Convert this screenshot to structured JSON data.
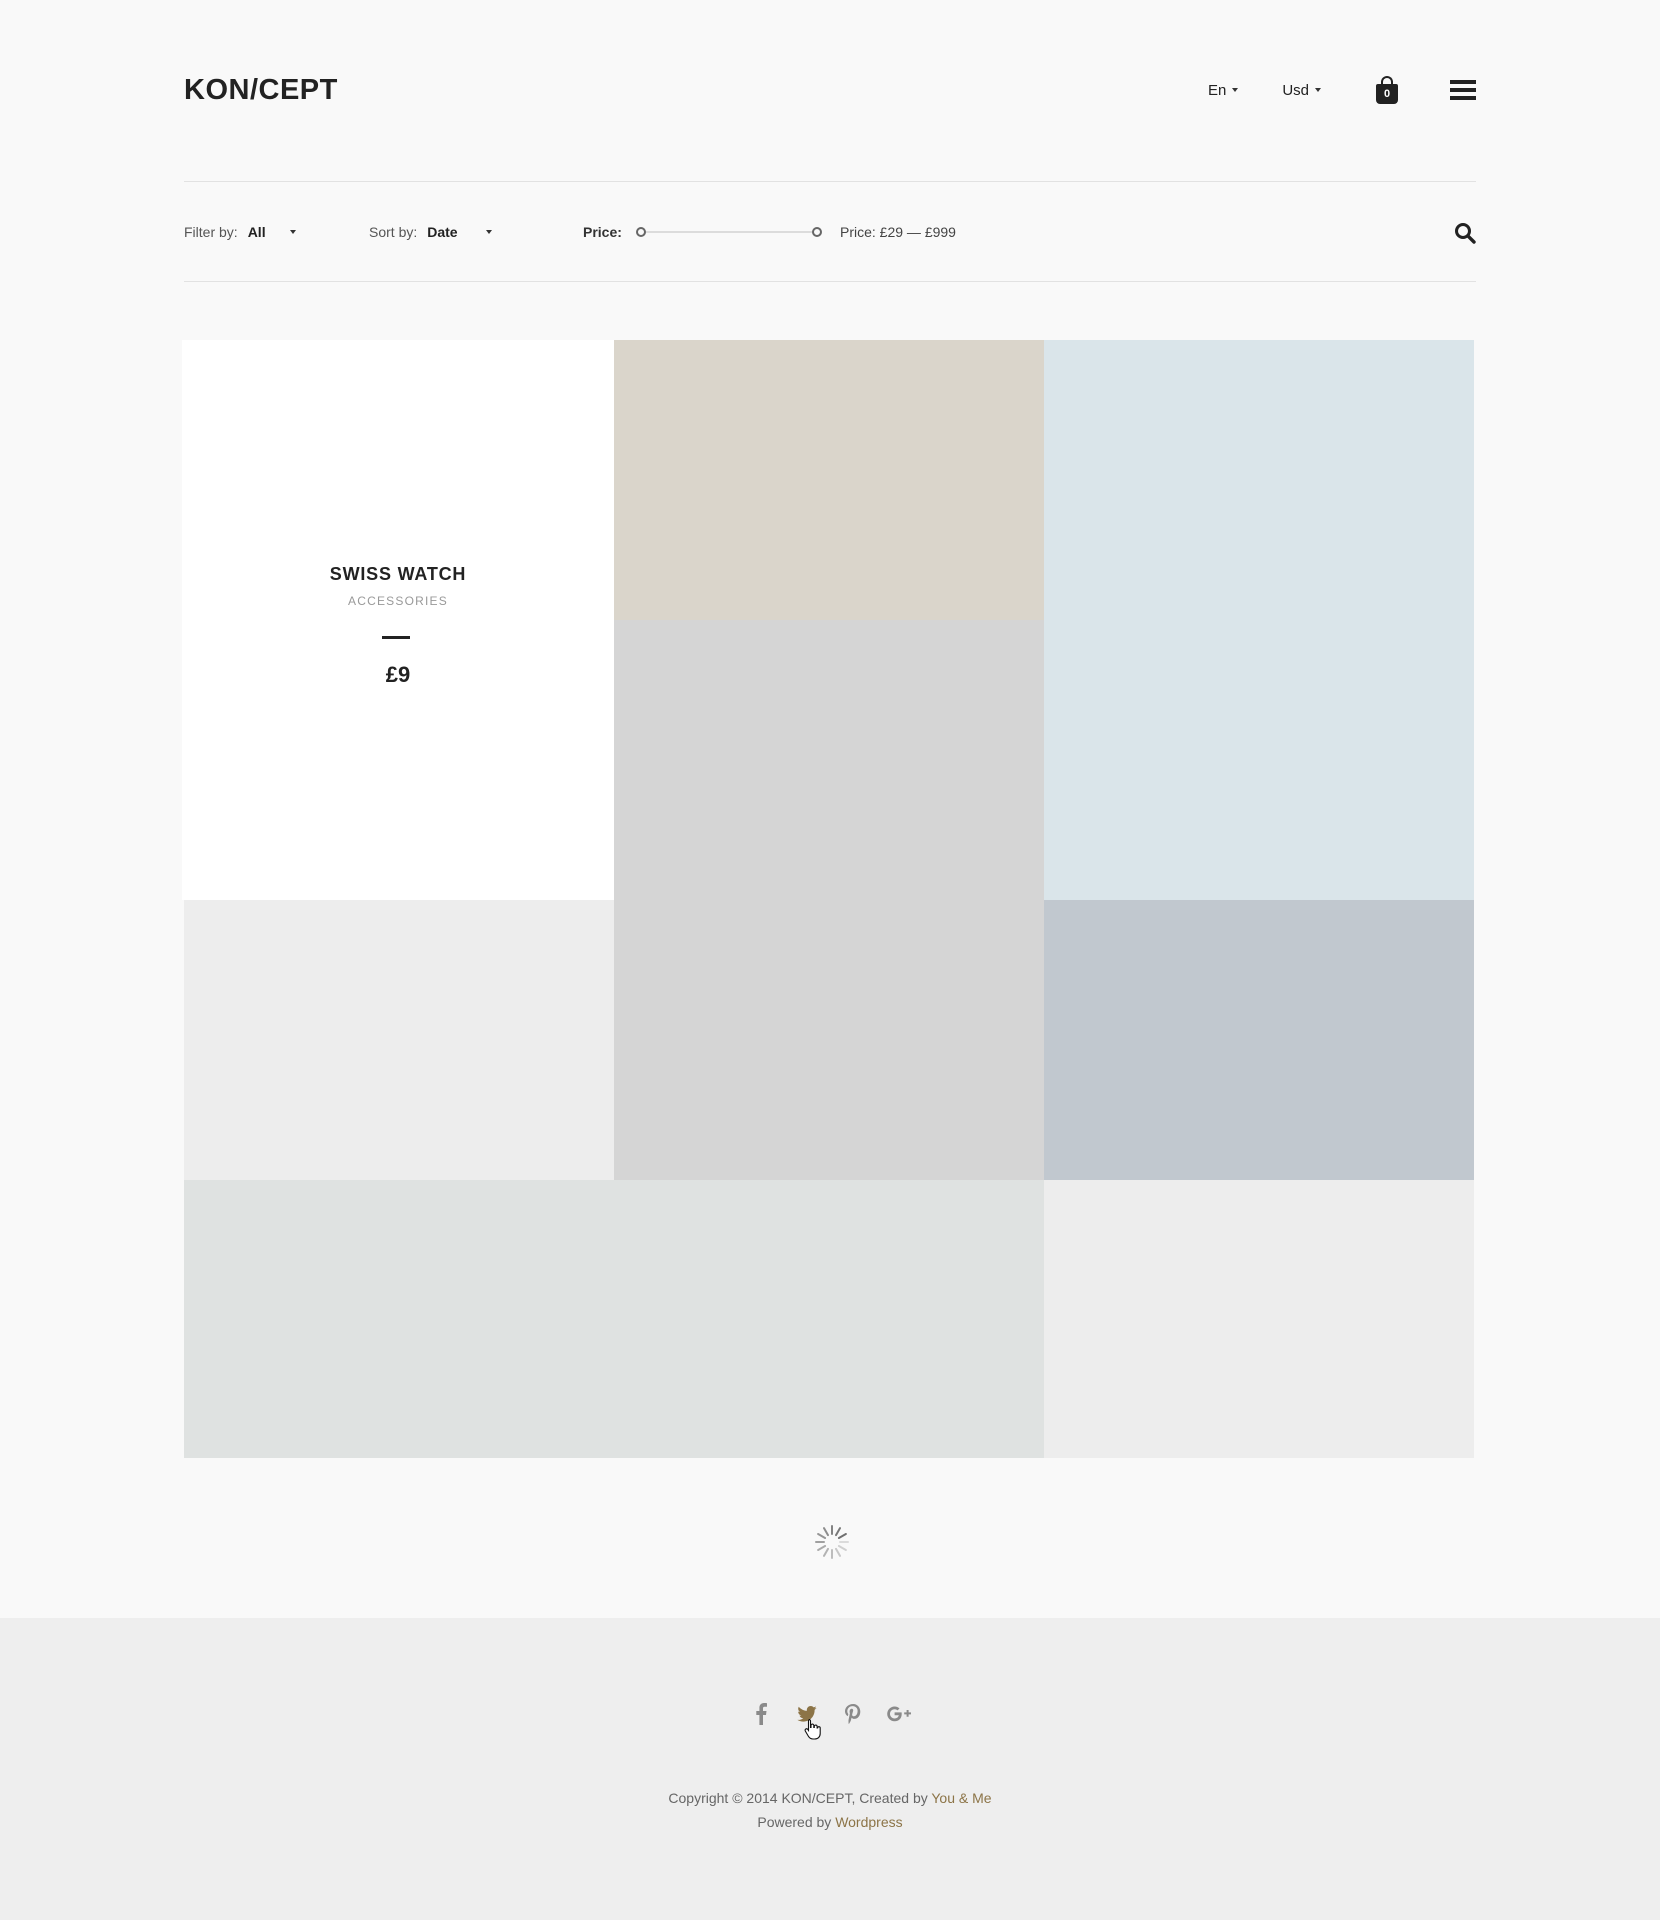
{
  "header": {
    "logo": "KON/CEPT",
    "language": "En",
    "currency": "Usd",
    "cart_count": "0"
  },
  "filters": {
    "filter_label": "Filter by:",
    "filter_value": "All",
    "sort_label": "Sort by:",
    "sort_value": "Date",
    "price_label": "Price:",
    "price_range": "Price: £29 — £999"
  },
  "products": [
    {
      "name": "SWISS WATCH",
      "category": "ACCESSORIES",
      "price": "£9"
    }
  ],
  "placeholder_colors": [
    "#dad5cb",
    "#d5d5d5",
    "#dae5ea",
    "#ededed",
    "#c1c8cf",
    "#dfe2e1",
    "#ededed"
  ],
  "footer": {
    "social": [
      "facebook-icon",
      "twitter-icon",
      "pinterest-icon",
      "google-plus-icon"
    ],
    "copyright": "Copyright © 2014 KON/CEPT, Created by",
    "creator": "You & Me",
    "powered_by": "Powered by",
    "platform": "Wordpress"
  },
  "accent_color": "#8c7447"
}
